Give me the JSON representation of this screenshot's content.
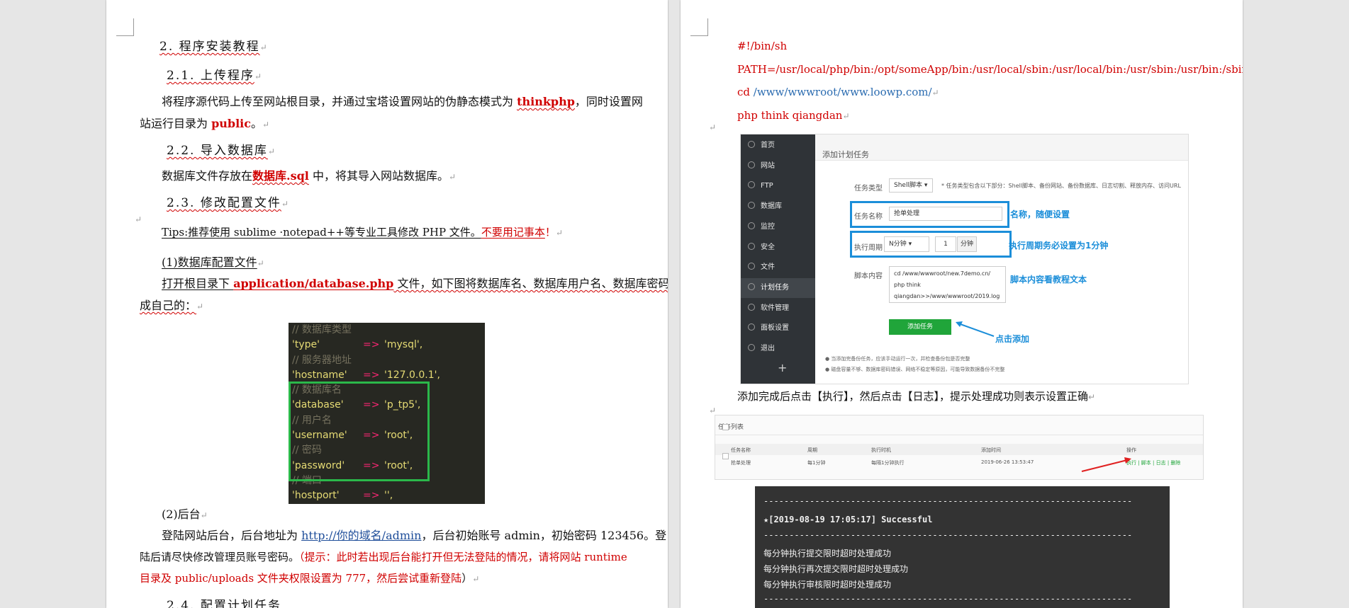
{
  "left_page": {
    "h2": "2. 程序安装教程",
    "h21": "2.1. 上传程序",
    "p1a_pre": "将程序源代码上传至网站根目录，并通过宝塔设置网站的伪静态模式为 ",
    "p1a_kw": "thinkphp",
    "p1a_post": "，同时设置网",
    "p1b_pre": "站运行目录为 ",
    "p1b_kw": "public",
    "p1b_post": "。",
    "h22": "2.2. 导入数据库",
    "p2_pre": "数据库文件存放在",
    "p2_kw": "数据库.sql",
    "p2_post": " 中，将其导入网站数据库。",
    "h23": "2.3. 修改配置文件",
    "tips_pre": "Tips:推荐使用 sublime ·notepad++等专业工具修改 PHP 文件。",
    "tips_red": "不要用记事本",
    "tips_post": "！",
    "s1": "(1)数据库配置文件",
    "p3a_pre": "打开根目录下 ",
    "p3a_kw": "application/database.php",
    "p3a_post": " 文件，如下图将数据库名、数据库用户名、数据库密码修改",
    "p3b": "成自己的：",
    "code": [
      {
        "k": "// 数据库类型",
        "type": "cm"
      },
      {
        "k": "'type'",
        "o": "=>",
        "v": "'mysql',",
        "type": "kv"
      },
      {
        "k": "// 服务器地址",
        "type": "cm"
      },
      {
        "k": "'hostname'",
        "o": "=>",
        "v": "'127.0.0.1',",
        "type": "kv"
      },
      {
        "k": "// 数据库名",
        "type": "cm"
      },
      {
        "k": "'database'",
        "o": "=>",
        "v": "'p_tp5',",
        "type": "kv"
      },
      {
        "k": "// 用户名",
        "type": "cm"
      },
      {
        "k": "'username'",
        "o": "=>",
        "v": "'root',",
        "type": "kv"
      },
      {
        "k": "// 密码",
        "type": "cm"
      },
      {
        "k": "'password'",
        "o": "=>",
        "v": "'root',",
        "type": "kv"
      },
      {
        "k": "// 端口",
        "type": "cm"
      },
      {
        "k": "'hostport'",
        "o": "=>",
        "v": "'',",
        "type": "kv"
      }
    ],
    "s2": "(2)后台",
    "p4a_pre": "登陆网站后台，后台地址为 ",
    "p4a_link": "http://你的域名/admin",
    "p4a_post": "，后台初始账号 admin，初始密码 123456。登",
    "p4b_pre": "陆后请尽快修改管理员账号密码。",
    "p4b_red": "（提示：此时若出现后台能打开但无法登陆的情况，请将网站 runtime",
    "p4c_red": "目录及 public/uploads 文件夹权限设置为 777，然后尝试重新登陆",
    "p4c_post": "）",
    "h24": "2.4. 配置计划任务"
  },
  "right_page": {
    "shebang": "#!/bin/sh",
    "path": "PATH=/usr/local/php/bin:/opt/someApp/bin:/usr/local/sbin:/usr/local/bin:/usr/sbin:/usr/bin:/sbin:/bin",
    "cd_pre": "cd ",
    "cd_link": "/www/wwwroot/www.loowp.com/",
    "php": "php think qiangdan",
    "panel": {
      "menu": [
        "首页",
        "网站",
        "FTP",
        "数据库",
        "监控",
        "安全",
        "文件",
        "计划任务",
        "软件管理",
        "面板设置",
        "退出"
      ],
      "active_index": 7,
      "plus": "+",
      "title": "添加计划任务",
      "task_type_label": "任务类型",
      "task_type_value": "Shell脚本",
      "task_type_note": "* 任务类型包含以下部分：Shell脚本、备份网站、备份数据库、日志切割、释放内存、访问URL",
      "task_name_label": "任务名称",
      "task_name_value": "抢单处理",
      "task_name_note": "名称，随便设置",
      "period_label": "执行周期",
      "period_value": "N分钟",
      "period_num": "1",
      "period_unit": "分钟",
      "period_note": "执行周期务必设置为1分钟",
      "script_label": "脚本内容",
      "script_lines": [
        "cd /www/wwwroot/new.7demo.cn/",
        "php think",
        "qiangdan>>/www/wwwroot/2019.log"
      ],
      "script_note": "脚本内容看教程文本",
      "add_btn": "添加任务",
      "add_note": "点击添加",
      "bullets": [
        "当添加完备份任务，应该手动运行一次，并检查备份包是否完整",
        "磁盘容量不够、数据库密码错误、网络不稳定等原因，可能导致数据备份不完整"
      ]
    },
    "done_text": "添加完成后点击【执行】，然后点击【日志】，提示处理成功则表示设置正确",
    "tasklist": {
      "title": "任务列表",
      "headers": [
        "任务名称",
        "周期",
        "执行时机",
        "添加时间",
        "操作"
      ],
      "row": [
        "抢单处理",
        "每1分钟",
        "每隔1分钟执行",
        "2019-06-26 13:53:47",
        "执行 | 脚本 | 日志 | 删除"
      ]
    },
    "terminal": {
      "dash": "------------------------------------------------------------------------",
      "status": "★[2019-08-19 17:05:17] Successful",
      "lines": [
        "每分钟执行提交限时超时处理成功",
        "每分钟执行再次提交限时超时处理成功",
        "每分钟执行审核限时超时处理成功"
      ]
    }
  },
  "colors": {
    "red": "#d00000",
    "green_box": "#2bb84a",
    "blue_box": "#1b8ed9",
    "btn_green": "#20a53a",
    "code_bg": "#272822"
  }
}
